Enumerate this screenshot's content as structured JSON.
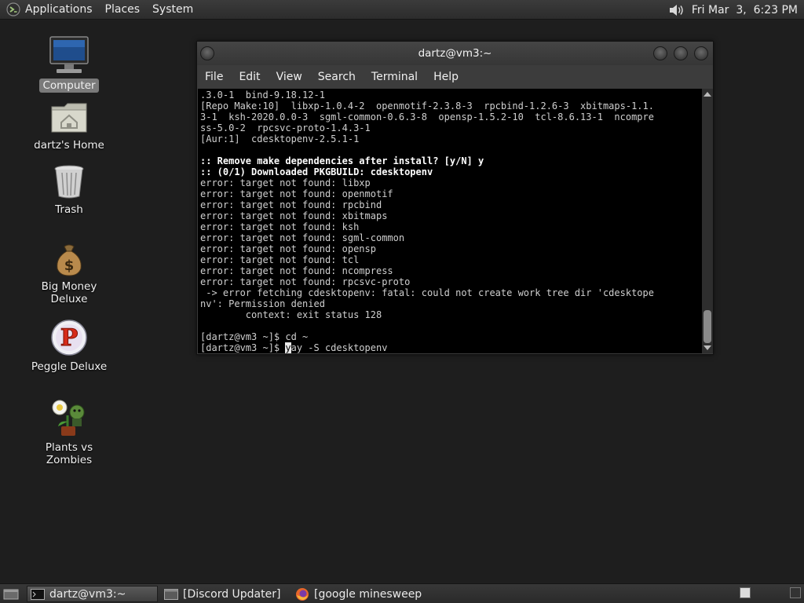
{
  "top_panel": {
    "menus": [
      "Applications",
      "Places",
      "System"
    ],
    "clock": "Fri Mar  3,  6:23 PM"
  },
  "desktop_icons": [
    {
      "label": "Computer",
      "icon": "computer-icon",
      "selected": true
    },
    {
      "label": "dartz's Home",
      "icon": "home-folder-icon"
    },
    {
      "label": "Trash",
      "icon": "trash-icon"
    },
    {
      "label": "Big Money Deluxe",
      "icon": "money-bag-icon"
    },
    {
      "label": "Peggle Deluxe",
      "icon": "peggle-icon"
    },
    {
      "label": "Plants vs Zombies",
      "icon": "plants-vs-zombies-icon"
    }
  ],
  "terminal": {
    "title": "dartz@vm3:~",
    "menu": [
      "File",
      "Edit",
      "View",
      "Search",
      "Terminal",
      "Help"
    ],
    "lines": [
      {
        "text": ".3.0-1  bind-9.18.12-1"
      },
      {
        "text": "[Repo Make:10]  libxp-1.0.4-2  openmotif-2.3.8-3  rpcbind-1.2.6-3  xbitmaps-1.1."
      },
      {
        "text": "3-1  ksh-2020.0.0-3  sgml-common-0.6.3-8  opensp-1.5.2-10  tcl-8.6.13-1  ncompre"
      },
      {
        "text": "ss-5.0-2  rpcsvc-proto-1.4.3-1"
      },
      {
        "text": "[Aur:1]  cdesktopenv-2.5.1-1"
      },
      {
        "text": ""
      },
      {
        "text": ":: Remove make dependencies after install? [y/N] y",
        "bold": true
      },
      {
        "text": ":: (0/1) Downloaded PKGBUILD: cdesktopenv",
        "bold": true
      },
      {
        "text": "error: target not found: libxp"
      },
      {
        "text": "error: target not found: openmotif"
      },
      {
        "text": "error: target not found: rpcbind"
      },
      {
        "text": "error: target not found: xbitmaps"
      },
      {
        "text": "error: target not found: ksh"
      },
      {
        "text": "error: target not found: sgml-common"
      },
      {
        "text": "error: target not found: opensp"
      },
      {
        "text": "error: target not found: tcl"
      },
      {
        "text": "error: target not found: ncompress"
      },
      {
        "text": "error: target not found: rpcsvc-proto"
      },
      {
        "text": " -> error fetching cdesktopenv: fatal: could not create work tree dir 'cdesktope"
      },
      {
        "text": "nv': Permission denied"
      },
      {
        "text": "        context: exit status 128"
      },
      {
        "text": ""
      },
      {
        "text": "[dartz@vm3 ~]$ cd ~"
      }
    ],
    "prompt_line": {
      "prompt": "[dartz@vm3 ~]$ ",
      "cursor_char": "y",
      "rest": "ay -S cdesktopenv"
    }
  },
  "taskbar": {
    "tasks": [
      {
        "label": "dartz@vm3:~",
        "icon": "terminal-icon",
        "active": true
      },
      {
        "label": "[Discord Updater]",
        "icon": "window-icon"
      },
      {
        "label": "[google minesweep...",
        "icon": "firefox-icon"
      }
    ]
  }
}
